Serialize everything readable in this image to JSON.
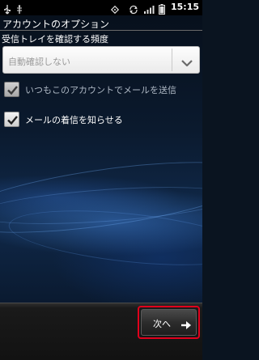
{
  "status_bar": {
    "time": "15:15",
    "icons": [
      "usb-icon",
      "usb-debug-icon",
      "screen-rotation-icon",
      "sync-icon",
      "signal-icon",
      "battery-icon"
    ]
  },
  "screen": {
    "title": "アカウントのオプション",
    "frequency_label": "受信トレイを確認する頻度",
    "frequency_spinner": {
      "selected": "自動確認しない"
    },
    "options": [
      {
        "label": "いつもこのアカウントでメールを送信",
        "checked": true,
        "enabled": false
      },
      {
        "label": "メールの着信を知らせる",
        "checked": true,
        "enabled": true
      }
    ]
  },
  "bottom_bar": {
    "next_label": "次へ"
  },
  "colors": {
    "highlight": "#e0001c",
    "check": "#202020"
  }
}
